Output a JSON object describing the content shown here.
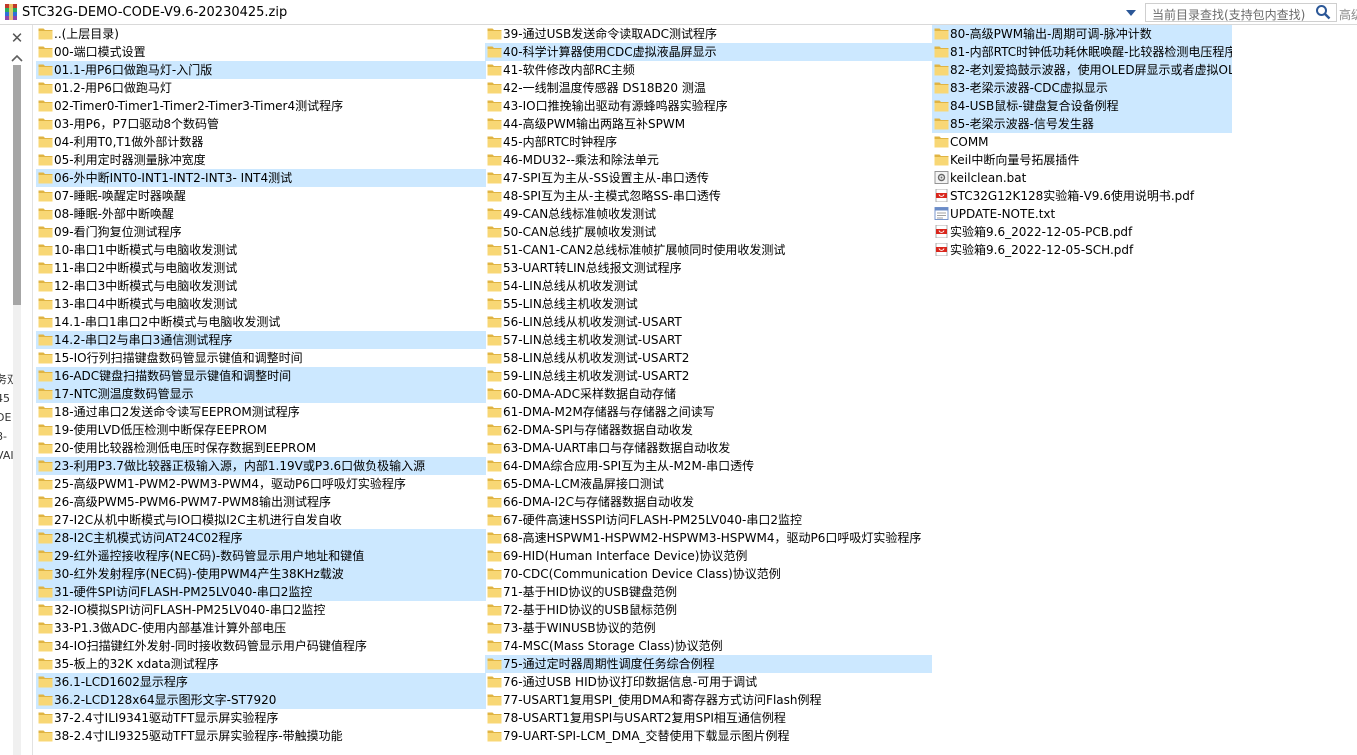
{
  "window": {
    "path": "STC32G-DEMO-CODE-V9.6-20230425.zip",
    "search_placeholder": "当前目录查找(支持包内查找)",
    "search_extra": "高级"
  },
  "left_pane": {
    "close_label": "✕",
    "cut_text": [
      "务双",
      "45",
      "DE",
      "8-",
      "VAI"
    ]
  },
  "columns": [
    [
      {
        "name": "..(上层目录)",
        "type": "folder",
        "selected": false
      },
      {
        "name": "00-端口模式设置",
        "type": "folder",
        "selected": false
      },
      {
        "name": "01.1-用P6口做跑马灯-入门版",
        "type": "folder",
        "selected": true
      },
      {
        "name": "01.2-用P6口做跑马灯",
        "type": "folder",
        "selected": false
      },
      {
        "name": "02-Timer0-Timer1-Timer2-Timer3-Timer4测试程序",
        "type": "folder",
        "selected": false
      },
      {
        "name": "03-用P6，P7口驱动8个数码管",
        "type": "folder",
        "selected": false
      },
      {
        "name": "04-利用T0,T1做外部计数器",
        "type": "folder",
        "selected": false
      },
      {
        "name": "05-利用定时器测量脉冲宽度",
        "type": "folder",
        "selected": false
      },
      {
        "name": "06-外中断INT0-INT1-INT2-INT3- INT4测试",
        "type": "folder",
        "selected": true
      },
      {
        "name": "07-睡眠-唤醒定时器唤醒",
        "type": "folder",
        "selected": false
      },
      {
        "name": "08-睡眠-外部中断唤醒",
        "type": "folder",
        "selected": false
      },
      {
        "name": "09-看门狗复位测试程序",
        "type": "folder",
        "selected": false
      },
      {
        "name": "10-串口1中断模式与电脑收发测试",
        "type": "folder",
        "selected": false
      },
      {
        "name": "11-串口2中断模式与电脑收发测试",
        "type": "folder",
        "selected": false
      },
      {
        "name": "12-串口3中断模式与电脑收发测试",
        "type": "folder",
        "selected": false
      },
      {
        "name": "13-串口4中断模式与电脑收发测试",
        "type": "folder",
        "selected": false
      },
      {
        "name": "14.1-串口1串口2中断模式与电脑收发测试",
        "type": "folder",
        "selected": false
      },
      {
        "name": "14.2-串口2与串口3通信测试程序",
        "type": "folder",
        "selected": true
      },
      {
        "name": "15-IO行列扫描键盘数码管显示键值和调整时间",
        "type": "folder",
        "selected": false
      },
      {
        "name": "16-ADC键盘扫描数码管显示键值和调整时间",
        "type": "folder",
        "selected": true
      },
      {
        "name": "17-NTC测温度数码管显示",
        "type": "folder",
        "selected": true
      },
      {
        "name": "18-通过串口2发送命令读写EEPROM测试程序",
        "type": "folder",
        "selected": false
      },
      {
        "name": "19-使用LVD低压检测中断保存EEPROM",
        "type": "folder",
        "selected": false
      },
      {
        "name": "20-使用比较器检测低电压时保存数据到EEPROM",
        "type": "folder",
        "selected": false
      },
      {
        "name": "23-利用P3.7做比较器正极输入源，内部1.19V或P3.6口做负极输入源",
        "type": "folder",
        "selected": true
      },
      {
        "name": "25-高级PWM1-PWM2-PWM3-PWM4，驱动P6口呼吸灯实验程序",
        "type": "folder",
        "selected": false
      },
      {
        "name": "26-高级PWM5-PWM6-PWM7-PWM8输出测试程序",
        "type": "folder",
        "selected": false
      },
      {
        "name": "27-I2C从机中断模式与IO口模拟I2C主机进行自发自收",
        "type": "folder",
        "selected": false
      },
      {
        "name": "28-I2C主机模式访问AT24C02程序",
        "type": "folder",
        "selected": true
      },
      {
        "name": "29-红外遥控接收程序(NEC码)-数码管显示用户地址和键值",
        "type": "folder",
        "selected": true
      },
      {
        "name": "30-红外发射程序(NEC码)-使用PWM4产生38KHz载波",
        "type": "folder",
        "selected": true
      },
      {
        "name": "31-硬件SPI访问FLASH-PM25LV040-串口2监控",
        "type": "folder",
        "selected": true
      },
      {
        "name": "32-IO模拟SPI访问FLASH-PM25LV040-串口2监控",
        "type": "folder",
        "selected": false
      },
      {
        "name": "33-P1.3做ADC-使用内部基准计算外部电压",
        "type": "folder",
        "selected": false
      },
      {
        "name": "34-IO扫描键红外发射-同时接收数码管显示用户码键值程序",
        "type": "folder",
        "selected": false
      },
      {
        "name": "35-板上的32K xdata测试程序",
        "type": "folder",
        "selected": false
      },
      {
        "name": "36.1-LCD1602显示程序",
        "type": "folder",
        "selected": true
      },
      {
        "name": "36.2-LCD128x64显示图形文字-ST7920",
        "type": "folder",
        "selected": true
      },
      {
        "name": "37-2.4寸ILI9341驱动TFT显示屏实验程序",
        "type": "folder",
        "selected": false
      },
      {
        "name": "38-2.4寸ILI9325驱动TFT显示屏实验程序-带触摸功能",
        "type": "folder",
        "selected": false
      }
    ],
    [
      {
        "name": "39-通过USB发送命令读取ADC测试程序",
        "type": "folder",
        "selected": false
      },
      {
        "name": "40-科学计算器使用CDC虚拟液晶屏显示",
        "type": "folder",
        "selected": true
      },
      {
        "name": "41-软件修改内部RC主频",
        "type": "folder",
        "selected": false
      },
      {
        "name": "42-一线制温度传感器 DS18B20 测温",
        "type": "folder",
        "selected": false
      },
      {
        "name": "43-IO口推挽输出驱动有源蜂鸣器实验程序",
        "type": "folder",
        "selected": false
      },
      {
        "name": "44-高级PWM输出两路互补SPWM",
        "type": "folder",
        "selected": false
      },
      {
        "name": "45-内部RTC时钟程序",
        "type": "folder",
        "selected": false
      },
      {
        "name": "46-MDU32--乘法和除法单元",
        "type": "folder",
        "selected": false
      },
      {
        "name": "47-SPI互为主从-SS设置主从-串口透传",
        "type": "folder",
        "selected": false
      },
      {
        "name": "48-SPI互为主从-主模式忽略SS-串口透传",
        "type": "folder",
        "selected": false
      },
      {
        "name": "49-CAN总线标准帧收发测试",
        "type": "folder",
        "selected": false
      },
      {
        "name": "50-CAN总线扩展帧收发测试",
        "type": "folder",
        "selected": false
      },
      {
        "name": "51-CAN1-CAN2总线标准帧扩展帧同时使用收发测试",
        "type": "folder",
        "selected": false
      },
      {
        "name": "53-UART转LIN总线报文测试程序",
        "type": "folder",
        "selected": false
      },
      {
        "name": "54-LIN总线从机收发测试",
        "type": "folder",
        "selected": false
      },
      {
        "name": "55-LIN总线主机收发测试",
        "type": "folder",
        "selected": false
      },
      {
        "name": "56-LIN总线从机收发测试-USART",
        "type": "folder",
        "selected": false
      },
      {
        "name": "57-LIN总线主机收发测试-USART",
        "type": "folder",
        "selected": false
      },
      {
        "name": "58-LIN总线从机收发测试-USART2",
        "type": "folder",
        "selected": false
      },
      {
        "name": "59-LIN总线主机收发测试-USART2",
        "type": "folder",
        "selected": false
      },
      {
        "name": "60-DMA-ADC采样数据自动存储",
        "type": "folder",
        "selected": false
      },
      {
        "name": "61-DMA-M2M存储器与存储器之间读写",
        "type": "folder",
        "selected": false
      },
      {
        "name": "62-DMA-SPI与存储器数据自动收发",
        "type": "folder",
        "selected": false
      },
      {
        "name": "63-DMA-UART串口与存储器数据自动收发",
        "type": "folder",
        "selected": false
      },
      {
        "name": "64-DMA综合应用-SPI互为主从-M2M-串口透传",
        "type": "folder",
        "selected": false
      },
      {
        "name": "65-DMA-LCM液晶屏接口测试",
        "type": "folder",
        "selected": false
      },
      {
        "name": "66-DMA-I2C与存储器数据自动收发",
        "type": "folder",
        "selected": false
      },
      {
        "name": "67-硬件高速HSSPI访问FLASH-PM25LV040-串口2监控",
        "type": "folder",
        "selected": false
      },
      {
        "name": "68-高速HSPWM1-HSPWM2-HSPWM3-HSPWM4，驱动P6口呼吸灯实验程序",
        "type": "folder",
        "selected": false
      },
      {
        "name": "69-HID(Human Interface Device)协议范例",
        "type": "folder",
        "selected": false
      },
      {
        "name": "70-CDC(Communication Device Class)协议范例",
        "type": "folder",
        "selected": false
      },
      {
        "name": "71-基于HID协议的USB键盘范例",
        "type": "folder",
        "selected": false
      },
      {
        "name": "72-基于HID协议的USB鼠标范例",
        "type": "folder",
        "selected": false
      },
      {
        "name": "73-基于WINUSB协议的范例",
        "type": "folder",
        "selected": false
      },
      {
        "name": "74-MSC(Mass Storage Class)协议范例",
        "type": "folder",
        "selected": false
      },
      {
        "name": "75-通过定时器周期性调度任务综合例程",
        "type": "folder",
        "selected": true
      },
      {
        "name": "76-通过USB HID协议打印数据信息-可用于调试",
        "type": "folder",
        "selected": false
      },
      {
        "name": "77-USART1复用SPI_使用DMA和寄存器方式访问Flash例程",
        "type": "folder",
        "selected": false
      },
      {
        "name": "78-USART1复用SPI与USART2复用SPI相互通信例程",
        "type": "folder",
        "selected": false
      },
      {
        "name": "79-UART-SPI-LCM_DMA_交替使用下载显示图片例程",
        "type": "folder",
        "selected": false
      }
    ],
    [
      {
        "name": "80-高级PWM输出-周期可调-脉冲计数",
        "type": "folder",
        "selected": true
      },
      {
        "name": "81-内部RTC时钟低功耗休眠唤醒-比较器检测电压程序",
        "type": "folder",
        "selected": true
      },
      {
        "name": "82-老刘爱捣鼓示波器，使用OLED屏显示或者虚拟OLED接口显示",
        "type": "folder",
        "selected": true
      },
      {
        "name": "83-老梁示波器-CDC虚拟显示",
        "type": "folder",
        "selected": true
      },
      {
        "name": "84-USB鼠标-键盘复合设备例程",
        "type": "folder",
        "selected": true
      },
      {
        "name": "85-老梁示波器-信号发生器",
        "type": "folder",
        "selected": true
      },
      {
        "name": "COMM",
        "type": "folder",
        "selected": false
      },
      {
        "name": "Keil中断向量号拓展插件",
        "type": "folder",
        "selected": false
      },
      {
        "name": "keilclean.bat",
        "type": "bat",
        "selected": false
      },
      {
        "name": "STC32G12K128实验箱-V9.6使用说明书.pdf",
        "type": "pdf",
        "selected": false
      },
      {
        "name": "UPDATE-NOTE.txt",
        "type": "txt",
        "selected": false
      },
      {
        "name": "实验箱9.6_2022-12-05-PCB.pdf",
        "type": "pdf",
        "selected": false
      },
      {
        "name": "实验箱9.6_2022-12-05-SCH.pdf",
        "type": "pdf",
        "selected": false
      }
    ]
  ],
  "colors": {
    "selection": "#cce8ff",
    "folder": "#f8d775",
    "folder_dark": "#e0b443",
    "pdf": "#d9261c",
    "scroll_thumb": "#a6a6a6"
  },
  "icons": {
    "folder": "folder-icon",
    "pdf": "pdf-file-icon",
    "txt": "text-file-icon",
    "bat": "batch-file-icon",
    "archive": "archive-icon",
    "search": "search-icon",
    "dropdown": "chevron-down-icon",
    "close": "close-icon"
  }
}
